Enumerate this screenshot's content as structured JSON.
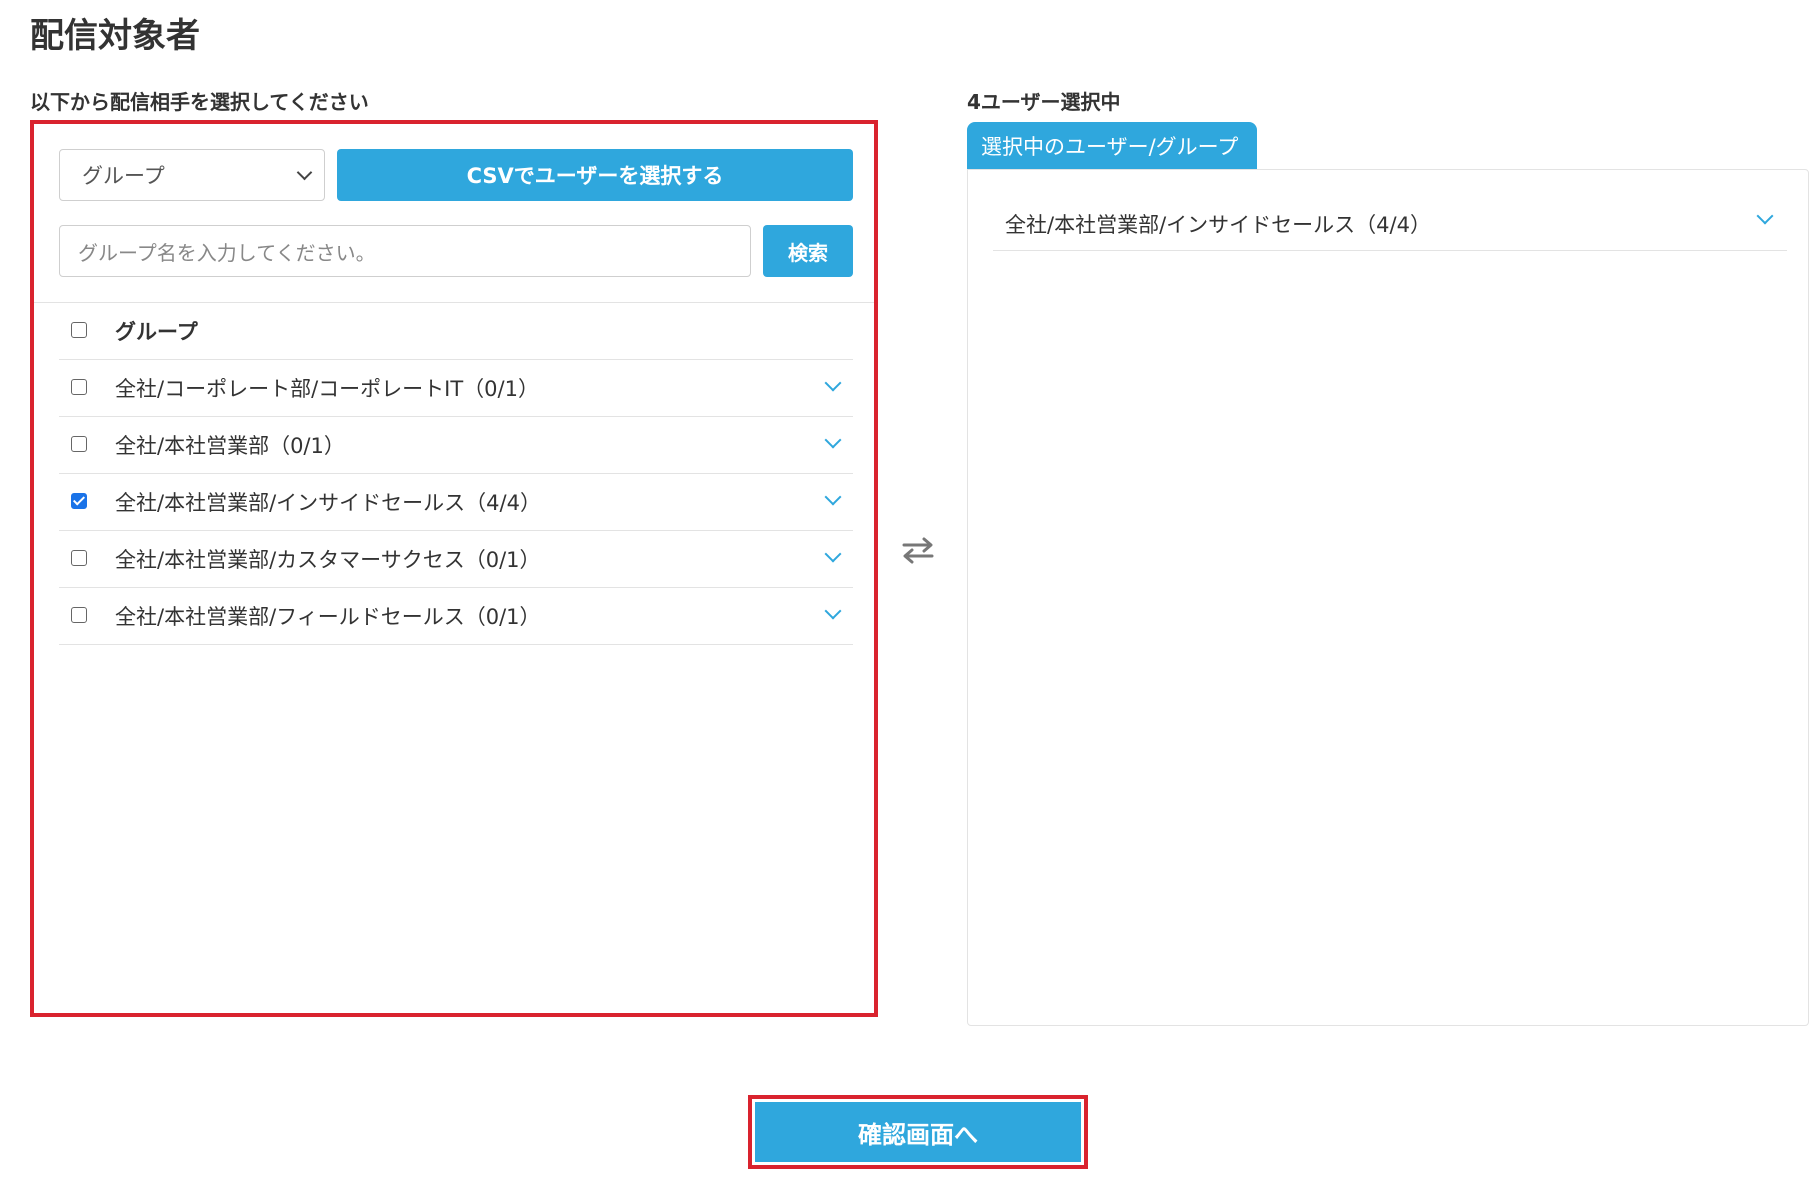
{
  "page_title": "配信対象者",
  "left": {
    "instruction": "以下から配信相手を選択してください",
    "type_select": {
      "value": "グループ"
    },
    "csv_button": "CSVでユーザーを選択する",
    "search": {
      "placeholder": "グループ名を入力してください。",
      "button": "検索"
    },
    "list_header": "グループ",
    "groups": [
      {
        "label": "全社/コーポレート部/コーポレートIT（0/1）",
        "checked": false
      },
      {
        "label": "全社/本社営業部（0/1）",
        "checked": false
      },
      {
        "label": "全社/本社営業部/インサイドセールス（4/4）",
        "checked": true
      },
      {
        "label": "全社/本社営業部/カスタマーサクセス（0/1）",
        "checked": false
      },
      {
        "label": "全社/本社営業部/フィールドセールス（0/1）",
        "checked": false
      }
    ]
  },
  "right": {
    "count_label": "4ユーザー選択中",
    "tab_label": "選択中のユーザー/グループ",
    "selected": [
      {
        "label": "全社/本社営業部/インサイドセールス（4/4）"
      }
    ]
  },
  "confirm_button": "確認画面へ",
  "colors": {
    "accent": "#2fa7dd",
    "highlight_border": "#d9232e",
    "checkbox_checked": "#1a73e8"
  },
  "icons": {
    "swap": "swap-arrows-icon",
    "expand": "chevron-down-icon"
  }
}
